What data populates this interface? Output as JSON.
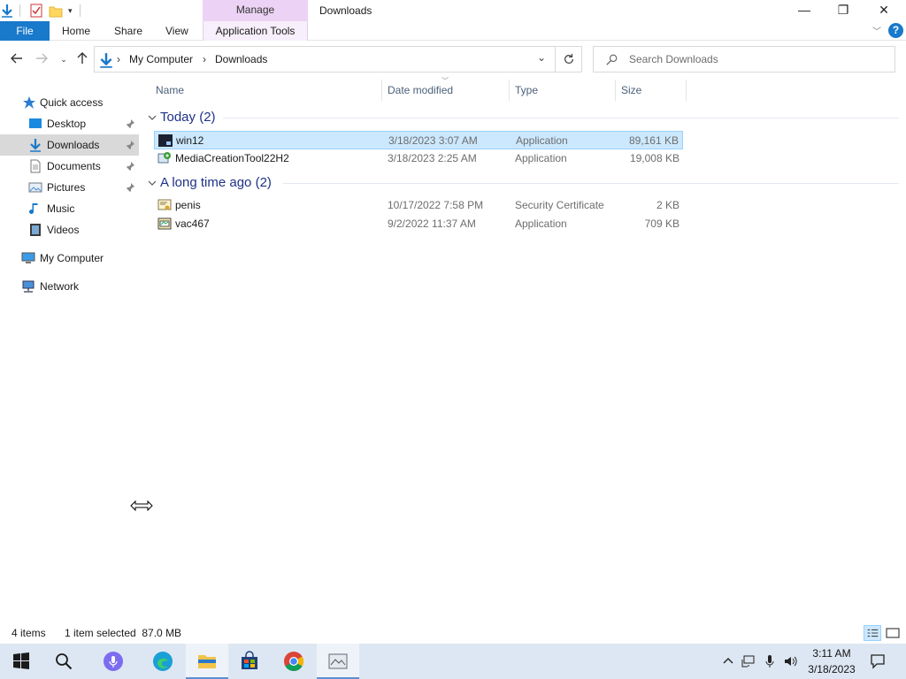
{
  "titlebar": {
    "manage_tab": "Manage",
    "window_title": "Downloads",
    "minimize_glyph": "—",
    "maximize_glyph": "❐",
    "close_glyph": "✕"
  },
  "ribbon": {
    "file": "File",
    "home": "Home",
    "share": "Share",
    "view": "View",
    "application_tools": "Application Tools",
    "help": "?"
  },
  "address": {
    "segments": [
      "My Computer",
      "Downloads"
    ],
    "separator": "›",
    "search_placeholder": "Search Downloads"
  },
  "nav": {
    "quick_access": "Quick access",
    "items": [
      {
        "label": "Desktop",
        "icon": "desktop-icon",
        "pinned": true
      },
      {
        "label": "Downloads",
        "icon": "downloads-icon",
        "pinned": true,
        "selected": true
      },
      {
        "label": "Documents",
        "icon": "documents-icon",
        "pinned": true
      },
      {
        "label": "Pictures",
        "icon": "pictures-icon",
        "pinned": true
      },
      {
        "label": "Music",
        "icon": "music-icon",
        "pinned": false
      },
      {
        "label": "Videos",
        "icon": "videos-icon",
        "pinned": false
      }
    ],
    "my_computer": "My Computer",
    "network": "Network"
  },
  "columns": {
    "name": "Name",
    "date_modified": "Date modified",
    "type": "Type",
    "size": "Size"
  },
  "groups": [
    {
      "title": "Today (2)",
      "files": [
        {
          "name": "win12",
          "date": "3/18/2023 3:07 AM",
          "type": "Application",
          "size": "89,161 KB",
          "icon": "app-dark-icon",
          "selected": true
        },
        {
          "name": "MediaCreationTool22H2",
          "date": "3/18/2023 2:25 AM",
          "type": "Application",
          "size": "19,008 KB",
          "icon": "media-creation-icon",
          "selected": false
        }
      ]
    },
    {
      "title": "A long time ago (2)",
      "files": [
        {
          "name": "penis",
          "date": "10/17/2022 7:58 PM",
          "type": "Security Certificate",
          "size": "2 KB",
          "icon": "certificate-icon",
          "selected": false
        },
        {
          "name": "vac467",
          "date": "9/2/2022 11:37 AM",
          "type": "Application",
          "size": "709 KB",
          "icon": "app-generic-icon",
          "selected": false
        }
      ]
    }
  ],
  "status": {
    "item_count": "4 items",
    "selection": "1 item selected  87.0 MB"
  },
  "taskbar": {
    "time": "3:11 AM",
    "date": "3/18/2023"
  },
  "colors": {
    "accent": "#1979ca",
    "manage_tab": "#ecd3f5",
    "selection": "#cce8ff",
    "group_header": "#1e3287",
    "taskbar": "#dde7f3"
  }
}
